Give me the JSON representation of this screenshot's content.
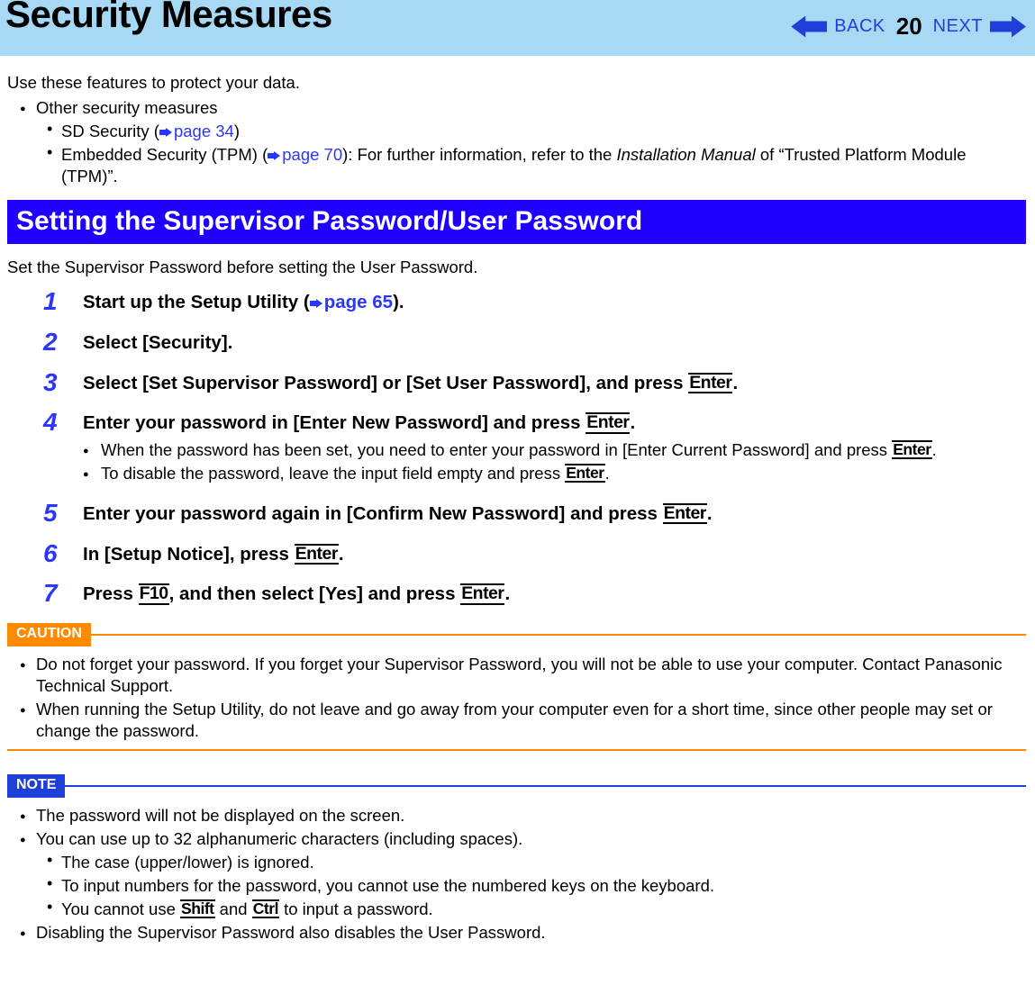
{
  "header": {
    "title": "Security Measures",
    "back_label": "BACK",
    "page_number": "20",
    "next_label": "NEXT"
  },
  "intro": {
    "text": "Use these features to protect your data.",
    "bullet_main": "Other security measures",
    "sub1_prefix": "SD Security (",
    "sub1_link": "page 34",
    "sub1_suffix": ")",
    "sub2_prefix": "Embedded Security (TPM) (",
    "sub2_link": "page 70",
    "sub2_mid": "): For further information, refer to the ",
    "sub2_italic": "Installation Manual",
    "sub2_tail": " of “Trusted Platform Module (TPM)”."
  },
  "section": {
    "banner": "Setting the Supervisor Password/User Password",
    "intro": "Set the Supervisor Password before setting the User Password."
  },
  "steps": {
    "s1_num": "1",
    "s1_a": "Start up the Setup Utility (",
    "s1_link": "page 65",
    "s1_b": ").",
    "s2_num": "2",
    "s2": "Select [Security].",
    "s3_num": "3",
    "s3_a": "Select [Set Supervisor Password] or [Set User Password], and press ",
    "s3_key": "Enter",
    "s3_b": ".",
    "s4_num": "4",
    "s4_a": "Enter your password in [Enter New Password] and press ",
    "s4_key": "Enter",
    "s4_b": ".",
    "s4_sub1_a": "When the password has been set, you need to enter your password in [Enter Current Password] and press ",
    "s4_sub1_key": "Enter",
    "s4_sub1_b": ".",
    "s4_sub2_a": "To disable the password, leave the input field empty and press ",
    "s4_sub2_key": "Enter",
    "s4_sub2_b": ".",
    "s5_num": "5",
    "s5_a": "Enter your password again in [Confirm New Password] and press ",
    "s5_key": "Enter",
    "s5_b": ".",
    "s6_num": "6",
    "s6_a": "In [Setup Notice], press ",
    "s6_key": "Enter",
    "s6_b": ".",
    "s7_num": "7",
    "s7_a": "Press ",
    "s7_key1": "F10",
    "s7_b": ", and then select [Yes] and press ",
    "s7_key2": "Enter",
    "s7_c": "."
  },
  "caution": {
    "label": "CAUTION",
    "b1": "Do not forget your password. If you forget your Supervisor Password, you will not be able to use your computer. Contact Panasonic Technical Support.",
    "b2": "When running the Setup Utility, do not leave and go away from your computer even for a short time, since other people may set or change the password."
  },
  "note": {
    "label": "NOTE",
    "b1": "The password will not be displayed on the screen.",
    "b2": "You can use up to 32 alphanumeric characters (including spaces).",
    "b2s1": "The case (upper/lower) is ignored.",
    "b2s2": "To input numbers for the password, you cannot use the numbered keys on the keyboard.",
    "b2s3_a": "You cannot use ",
    "b2s3_key1": "Shift",
    "b2s3_b": " and ",
    "b2s3_key2": "Ctrl",
    "b2s3_c": " to input a password.",
    "b3": "Disabling the Supervisor Password also disables the User Password."
  }
}
